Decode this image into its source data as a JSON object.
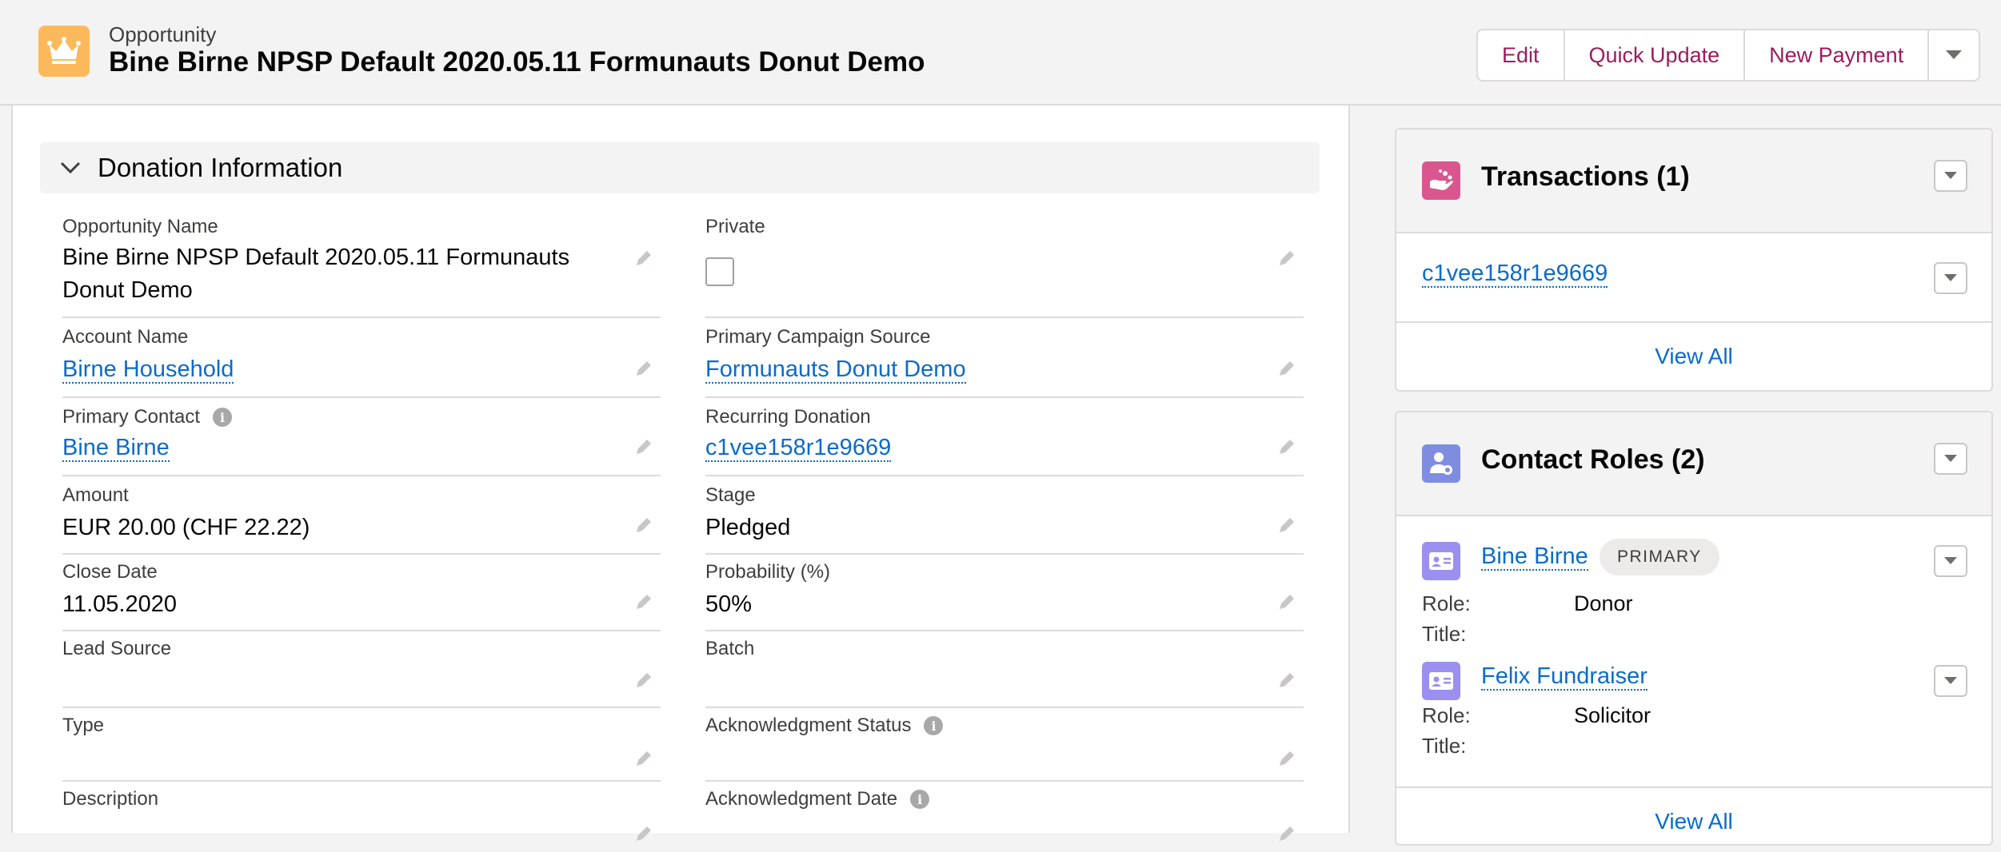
{
  "header": {
    "object_label": "Opportunity",
    "record_title": "Bine Birne NPSP Default 2020.05.11 Formunauts Donut Demo",
    "buttons": {
      "edit": "Edit",
      "quick_update": "Quick Update",
      "new_payment": "New Payment"
    }
  },
  "section": {
    "title": "Donation Information",
    "fields": {
      "opportunity_name": {
        "label": "Opportunity Name",
        "value_line1": "Bine Birne NPSP Default 2020.05.11 Formunauts",
        "value_line2": "Donut Demo"
      },
      "private": {
        "label": "Private",
        "checked": false
      },
      "account_name": {
        "label": "Account Name",
        "value": "Birne Household"
      },
      "primary_campaign_source": {
        "label": "Primary Campaign Source",
        "value": "Formunauts Donut Demo"
      },
      "primary_contact": {
        "label": "Primary Contact",
        "value": "Bine Birne"
      },
      "recurring_donation": {
        "label": "Recurring Donation",
        "value": "c1vee158r1e9669"
      },
      "amount": {
        "label": "Amount",
        "value": "EUR 20.00 (CHF 22.22)"
      },
      "stage": {
        "label": "Stage",
        "value": "Pledged"
      },
      "close_date": {
        "label": "Close Date",
        "value": "11.05.2020"
      },
      "probability": {
        "label": "Probability (%)",
        "value": "50%"
      },
      "lead_source": {
        "label": "Lead Source",
        "value": ""
      },
      "batch": {
        "label": "Batch",
        "value": ""
      },
      "type": {
        "label": "Type",
        "value": ""
      },
      "acknowledgment_status": {
        "label": "Acknowledgment Status",
        "value": ""
      },
      "description": {
        "label": "Description",
        "value": ""
      },
      "acknowledgment_date": {
        "label": "Acknowledgment Date",
        "value": ""
      }
    }
  },
  "transactions": {
    "title": "Transactions (1)",
    "items": [
      {
        "name": "c1vee158r1e9669"
      }
    ],
    "view_all": "View All"
  },
  "contact_roles": {
    "title": "Contact Roles (2)",
    "role_label": "Role:",
    "title_label": "Title:",
    "items": [
      {
        "name": "Bine Birne",
        "badge": "PRIMARY",
        "role": "Donor",
        "title": ""
      },
      {
        "name": "Felix Fundraiser",
        "role": "Solicitor",
        "title": ""
      }
    ],
    "view_all": "View All"
  },
  "colors": {
    "accent": "#9e1a5e",
    "link": "#0b6bcb",
    "opportunity_icon": "#fcb95b",
    "transactions_icon": "#d9578e",
    "contact_roles_icon": "#7f8de1",
    "contact_card_icon": "#9b8ff0"
  },
  "icons": [
    "crown-icon",
    "chevron-down-icon",
    "pencil-icon",
    "info-icon",
    "hand-coins-icon",
    "contact-role-icon",
    "contact-card-icon"
  ]
}
